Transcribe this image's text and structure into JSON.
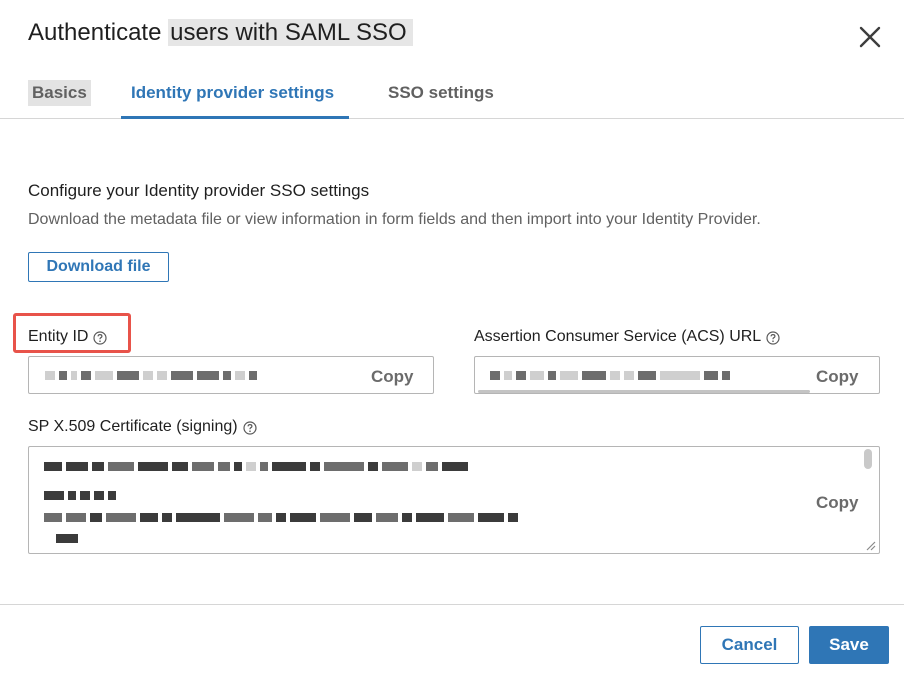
{
  "dialog": {
    "title_prefix": "Authenticate ",
    "title_highlight": "users with SAML SSO"
  },
  "tabs": [
    {
      "label": "Basics"
    },
    {
      "label": "Identity provider settings",
      "active": true
    },
    {
      "label": "SSO settings"
    }
  ],
  "section": {
    "heading": "Configure your Identity provider SSO settings",
    "description": "Download the metadata file or view information in form fields and then import into your Identity Provider.",
    "download_label": "Download file"
  },
  "fields": {
    "entity_id": {
      "label": "Entity ID",
      "copy_label": "Copy"
    },
    "acs_url": {
      "label": "Assertion Consumer Service (ACS) URL",
      "copy_label": "Copy"
    },
    "certificate": {
      "label": "SP X.509 Certificate (signing)",
      "copy_label": "Copy"
    }
  },
  "footer": {
    "cancel_label": "Cancel",
    "save_label": "Save"
  },
  "colors": {
    "accent": "#2f76b6",
    "highlight_box": "#e8534a"
  },
  "icons": {
    "close": "close-icon",
    "help": "help-circle-icon"
  }
}
